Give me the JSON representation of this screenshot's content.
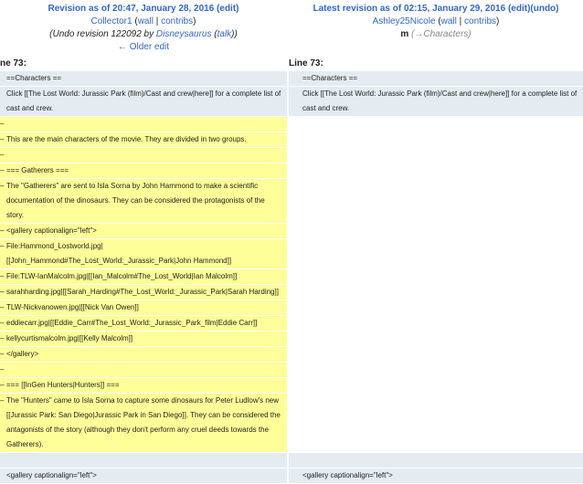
{
  "left_header": {
    "title_prefix": "Revision as of 20:47, January 28, 2016",
    "edit": "edit",
    "user": "Collector1",
    "wall": "wall",
    "contribs": "contribs",
    "summary_prefix": "(Undo revision 122092 by ",
    "summary_user": "Disneysaurus",
    "summary_talk": "talk",
    "summary_suffix": "))",
    "older_edit": "← Older edit"
  },
  "right_header": {
    "title_prefix": "Latest revision as of 02:15, January 29, 2016",
    "edit": "edit",
    "undo": "undo",
    "user": "Ashley25Nicole",
    "wall": "wall",
    "contribs": "contribs",
    "minor": "m",
    "comment": "(→Characters)"
  },
  "left_line_label": "ne 73:",
  "right_line_label": "Line 73:",
  "left_rows": [
    {
      "type": "ctx",
      "marker": "",
      "text": "==Characters =="
    },
    {
      "type": "ctx",
      "marker": "",
      "text": "Click [[The Lost World: Jurassic Park (film)/Cast and crew|here]] for a complete list of cast and crew."
    },
    {
      "type": "del",
      "marker": "–",
      "text": ""
    },
    {
      "type": "del",
      "marker": "–",
      "text": "This are the main characters of the movie. They are divided in two groups."
    },
    {
      "type": "del",
      "marker": "–",
      "text": ""
    },
    {
      "type": "del",
      "marker": "–",
      "text": "=== Gatherers ==="
    },
    {
      "type": "del",
      "marker": "–",
      "text": "The \"Gatherers\" are sent to Isla Sorna by John Hammond to make a scientific documentation of the dinosaurs. They can be considered the protagonists of the story."
    },
    {
      "type": "del",
      "marker": "–",
      "text": "<gallery captionalign=\"left\">"
    },
    {
      "type": "del",
      "marker": "–",
      "text": "File:Hammond_Lostworld.jpg|[[John_Hammond#The_Lost_World:_Jurassic_Park|John Hammond]]"
    },
    {
      "type": "del",
      "marker": "–",
      "text": "File:TLW-IanMalcolm.jpg|[[Ian_Malcolm#The_Lost_World|Ian Malcolm]]"
    },
    {
      "type": "del",
      "marker": "–",
      "text": "sarahharding.jpg|[[Sarah_Harding#The_Lost_World:_Jurassic_Park|Sarah Harding]]"
    },
    {
      "type": "del",
      "marker": "–",
      "text": "TLW-Nickvanowen.jpg|[[Nick Van Owen]]"
    },
    {
      "type": "del",
      "marker": "–",
      "text": "eddiecarr.jpg|[[Eddie_Carr#The_Lost_World:_Jurassic_Park_film|Eddie Carr]]"
    },
    {
      "type": "del",
      "marker": "–",
      "text": "kellycurtismalcolm.jpg|[[Kelly Malcolm]]"
    },
    {
      "type": "del",
      "marker": "–",
      "text": "</gallery>"
    },
    {
      "type": "del",
      "marker": "–",
      "text": ""
    },
    {
      "type": "del",
      "marker": "–",
      "text": "=== [[InGen Hunters|Hunters]] ==="
    },
    {
      "type": "del",
      "marker": "–",
      "text": "The \"Hunters\" came to Isla Sorna to capture some dinosaurs for Peter Ludlow's new [[Jurassic Park: San Diego|Jurassic Park in San Diego]]. They can be considered the antagonists of the story (although they don't perform any cruel deeds towards the Gatherers)."
    },
    {
      "type": "ctx",
      "marker": "",
      "text": ""
    },
    {
      "type": "ctx",
      "marker": "",
      "text": "<gallery captionalign=\"left\">"
    }
  ],
  "right_rows_top": [
    {
      "type": "ctx",
      "text": "==Characters =="
    },
    {
      "type": "ctx",
      "text": "Click [[The Lost World: Jurassic Park (film)/Cast and crew|here]] for a complete list of cast and crew."
    }
  ],
  "right_rows_bottom": [
    {
      "type": "ctx",
      "text": ""
    },
    {
      "type": "ctx",
      "text": "<gallery captionalign=\"left\">"
    }
  ]
}
